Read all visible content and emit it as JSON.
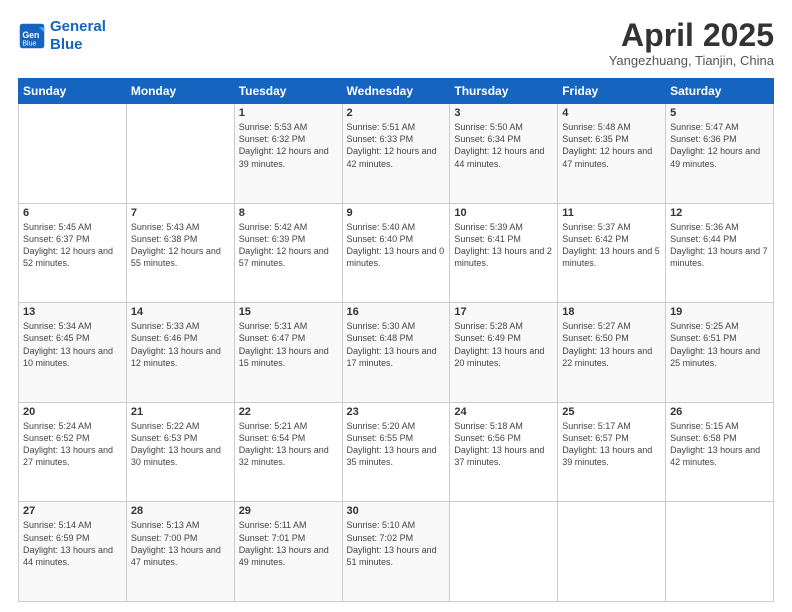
{
  "header": {
    "logo_line1": "General",
    "logo_line2": "Blue",
    "month_title": "April 2025",
    "location": "Yangezhuang, Tianjin, China"
  },
  "weekdays": [
    "Sunday",
    "Monday",
    "Tuesday",
    "Wednesday",
    "Thursday",
    "Friday",
    "Saturday"
  ],
  "weeks": [
    [
      {
        "day": "",
        "sunrise": "",
        "sunset": "",
        "daylight": ""
      },
      {
        "day": "",
        "sunrise": "",
        "sunset": "",
        "daylight": ""
      },
      {
        "day": "1",
        "sunrise": "Sunrise: 5:53 AM",
        "sunset": "Sunset: 6:32 PM",
        "daylight": "Daylight: 12 hours and 39 minutes."
      },
      {
        "day": "2",
        "sunrise": "Sunrise: 5:51 AM",
        "sunset": "Sunset: 6:33 PM",
        "daylight": "Daylight: 12 hours and 42 minutes."
      },
      {
        "day": "3",
        "sunrise": "Sunrise: 5:50 AM",
        "sunset": "Sunset: 6:34 PM",
        "daylight": "Daylight: 12 hours and 44 minutes."
      },
      {
        "day": "4",
        "sunrise": "Sunrise: 5:48 AM",
        "sunset": "Sunset: 6:35 PM",
        "daylight": "Daylight: 12 hours and 47 minutes."
      },
      {
        "day": "5",
        "sunrise": "Sunrise: 5:47 AM",
        "sunset": "Sunset: 6:36 PM",
        "daylight": "Daylight: 12 hours and 49 minutes."
      }
    ],
    [
      {
        "day": "6",
        "sunrise": "Sunrise: 5:45 AM",
        "sunset": "Sunset: 6:37 PM",
        "daylight": "Daylight: 12 hours and 52 minutes."
      },
      {
        "day": "7",
        "sunrise": "Sunrise: 5:43 AM",
        "sunset": "Sunset: 6:38 PM",
        "daylight": "Daylight: 12 hours and 55 minutes."
      },
      {
        "day": "8",
        "sunrise": "Sunrise: 5:42 AM",
        "sunset": "Sunset: 6:39 PM",
        "daylight": "Daylight: 12 hours and 57 minutes."
      },
      {
        "day": "9",
        "sunrise": "Sunrise: 5:40 AM",
        "sunset": "Sunset: 6:40 PM",
        "daylight": "Daylight: 13 hours and 0 minutes."
      },
      {
        "day": "10",
        "sunrise": "Sunrise: 5:39 AM",
        "sunset": "Sunset: 6:41 PM",
        "daylight": "Daylight: 13 hours and 2 minutes."
      },
      {
        "day": "11",
        "sunrise": "Sunrise: 5:37 AM",
        "sunset": "Sunset: 6:42 PM",
        "daylight": "Daylight: 13 hours and 5 minutes."
      },
      {
        "day": "12",
        "sunrise": "Sunrise: 5:36 AM",
        "sunset": "Sunset: 6:44 PM",
        "daylight": "Daylight: 13 hours and 7 minutes."
      }
    ],
    [
      {
        "day": "13",
        "sunrise": "Sunrise: 5:34 AM",
        "sunset": "Sunset: 6:45 PM",
        "daylight": "Daylight: 13 hours and 10 minutes."
      },
      {
        "day": "14",
        "sunrise": "Sunrise: 5:33 AM",
        "sunset": "Sunset: 6:46 PM",
        "daylight": "Daylight: 13 hours and 12 minutes."
      },
      {
        "day": "15",
        "sunrise": "Sunrise: 5:31 AM",
        "sunset": "Sunset: 6:47 PM",
        "daylight": "Daylight: 13 hours and 15 minutes."
      },
      {
        "day": "16",
        "sunrise": "Sunrise: 5:30 AM",
        "sunset": "Sunset: 6:48 PM",
        "daylight": "Daylight: 13 hours and 17 minutes."
      },
      {
        "day": "17",
        "sunrise": "Sunrise: 5:28 AM",
        "sunset": "Sunset: 6:49 PM",
        "daylight": "Daylight: 13 hours and 20 minutes."
      },
      {
        "day": "18",
        "sunrise": "Sunrise: 5:27 AM",
        "sunset": "Sunset: 6:50 PM",
        "daylight": "Daylight: 13 hours and 22 minutes."
      },
      {
        "day": "19",
        "sunrise": "Sunrise: 5:25 AM",
        "sunset": "Sunset: 6:51 PM",
        "daylight": "Daylight: 13 hours and 25 minutes."
      }
    ],
    [
      {
        "day": "20",
        "sunrise": "Sunrise: 5:24 AM",
        "sunset": "Sunset: 6:52 PM",
        "daylight": "Daylight: 13 hours and 27 minutes."
      },
      {
        "day": "21",
        "sunrise": "Sunrise: 5:22 AM",
        "sunset": "Sunset: 6:53 PM",
        "daylight": "Daylight: 13 hours and 30 minutes."
      },
      {
        "day": "22",
        "sunrise": "Sunrise: 5:21 AM",
        "sunset": "Sunset: 6:54 PM",
        "daylight": "Daylight: 13 hours and 32 minutes."
      },
      {
        "day": "23",
        "sunrise": "Sunrise: 5:20 AM",
        "sunset": "Sunset: 6:55 PM",
        "daylight": "Daylight: 13 hours and 35 minutes."
      },
      {
        "day": "24",
        "sunrise": "Sunrise: 5:18 AM",
        "sunset": "Sunset: 6:56 PM",
        "daylight": "Daylight: 13 hours and 37 minutes."
      },
      {
        "day": "25",
        "sunrise": "Sunrise: 5:17 AM",
        "sunset": "Sunset: 6:57 PM",
        "daylight": "Daylight: 13 hours and 39 minutes."
      },
      {
        "day": "26",
        "sunrise": "Sunrise: 5:15 AM",
        "sunset": "Sunset: 6:58 PM",
        "daylight": "Daylight: 13 hours and 42 minutes."
      }
    ],
    [
      {
        "day": "27",
        "sunrise": "Sunrise: 5:14 AM",
        "sunset": "Sunset: 6:59 PM",
        "daylight": "Daylight: 13 hours and 44 minutes."
      },
      {
        "day": "28",
        "sunrise": "Sunrise: 5:13 AM",
        "sunset": "Sunset: 7:00 PM",
        "daylight": "Daylight: 13 hours and 47 minutes."
      },
      {
        "day": "29",
        "sunrise": "Sunrise: 5:11 AM",
        "sunset": "Sunset: 7:01 PM",
        "daylight": "Daylight: 13 hours and 49 minutes."
      },
      {
        "day": "30",
        "sunrise": "Sunrise: 5:10 AM",
        "sunset": "Sunset: 7:02 PM",
        "daylight": "Daylight: 13 hours and 51 minutes."
      },
      {
        "day": "",
        "sunrise": "",
        "sunset": "",
        "daylight": ""
      },
      {
        "day": "",
        "sunrise": "",
        "sunset": "",
        "daylight": ""
      },
      {
        "day": "",
        "sunrise": "",
        "sunset": "",
        "daylight": ""
      }
    ]
  ]
}
